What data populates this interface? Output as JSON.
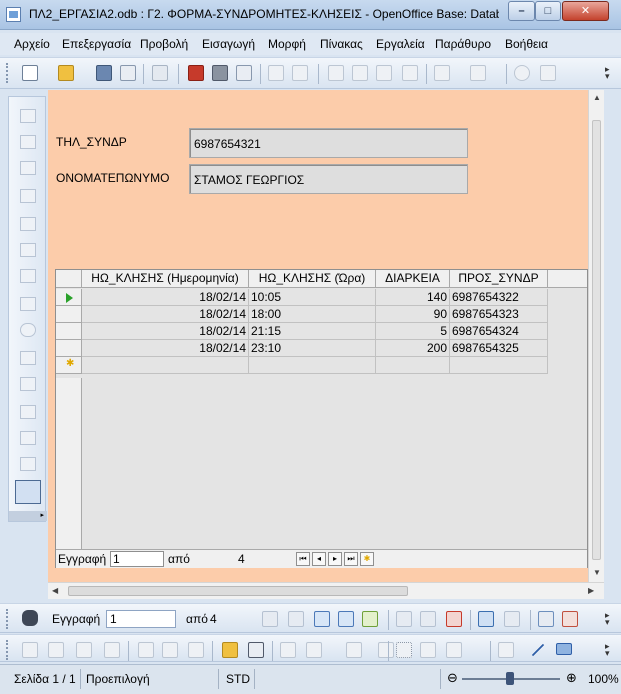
{
  "window": {
    "title": "ΠΛ2_ΕΡΓΑΣΙΑ2.odb : Γ2. ΦΟΡΜΑ-ΣΥΝΔΡΟΜΗΤΕΣ-ΚΛΗΣΕΙΣ - OpenOffice Base: Database",
    "minimize": "–",
    "maximize": "□",
    "close": "✕"
  },
  "menu": [
    "Αρχείο",
    "Επεξεργασία",
    "Προβολή",
    "Εισαγωγή",
    "Μορφή",
    "Πίνακας",
    "Εργαλεία",
    "Παράθυρο",
    "Βοήθεια"
  ],
  "form": {
    "phone_label": "ΤΗΛ_ΣΥΝΔΡ",
    "phone_value": "6987654321",
    "name_label": "ΟΝΟΜΑΤΕΠΩΝΥΜΟ",
    "name_value": "ΣΤΑΜΟΣ ΓΕΩΡΓΙΟΣ"
  },
  "grid": {
    "columns": [
      "ΗΩ_ΚΛΗΣΗΣ (Ημερομηνία)",
      "ΗΩ_ΚΛΗΣΗΣ (Ώρα)",
      "ΔΙΑΡΚΕΙΑ",
      "ΠΡΟΣ_ΣΥΝΔΡ"
    ],
    "rows": [
      [
        "18/02/14",
        "10:05",
        "140",
        "6987654322"
      ],
      [
        "18/02/14",
        "18:00",
        "90",
        "6987654323"
      ],
      [
        "18/02/14",
        "21:15",
        "5",
        "6987654324"
      ],
      [
        "18/02/14",
        "23:10",
        "200",
        "6987654325"
      ]
    ],
    "nav": {
      "record_label": "Εγγραφή",
      "record_value": "1",
      "of_label": "από",
      "total": "4"
    }
  },
  "navbar": {
    "record_label": "Εγγραφή",
    "record_value": "1",
    "of_label": "από",
    "total": "4"
  },
  "status": {
    "page": "Σελίδα 1 / 1",
    "mode": "Προεπιλογή",
    "std": "STD",
    "zoom": "100%"
  }
}
